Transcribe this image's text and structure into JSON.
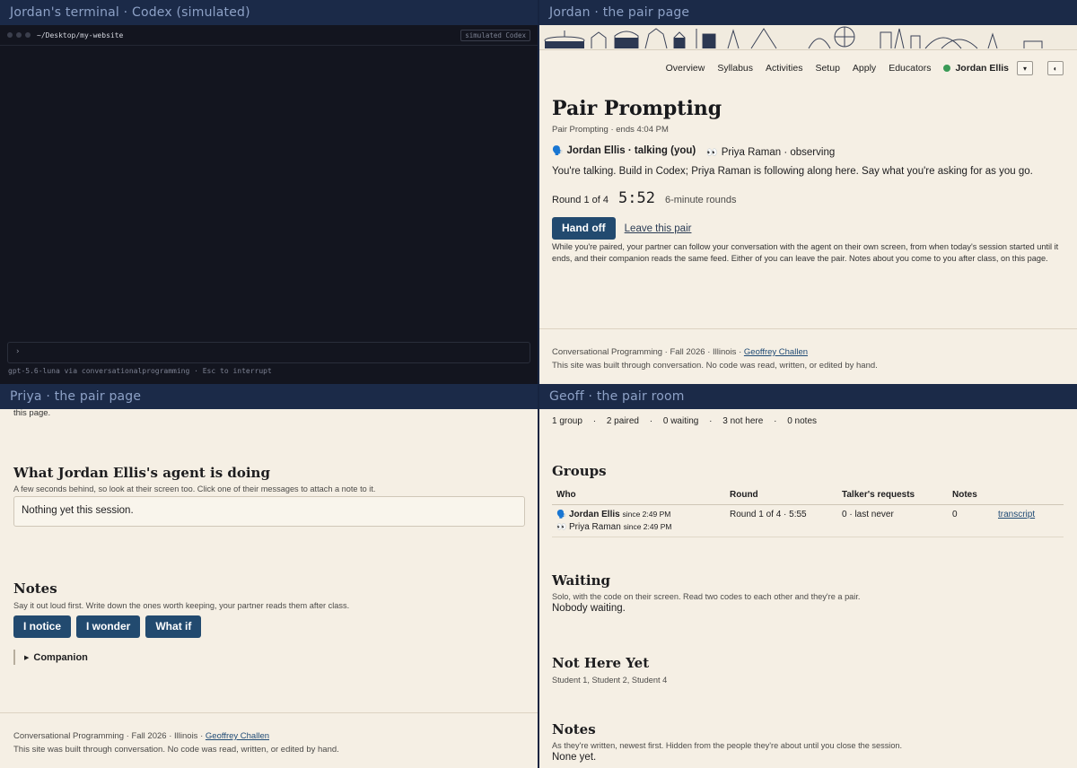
{
  "panes": {
    "terminal": {
      "label": "Jordan's terminal · Codex (simulated)",
      "path": "~/Desktop/my-website",
      "tag": "simulated Codex",
      "prompt_glyph": "›",
      "status": "gpt-5.6-luna via conversationalprogramming  ·  Esc to interrupt"
    },
    "jordan": {
      "label": "Jordan · the pair page"
    },
    "priya": {
      "label": "Priya · the pair page"
    },
    "geoff": {
      "label": "Geoff · the pair room"
    }
  },
  "nav": {
    "items": [
      "Overview",
      "Syllabus",
      "Activities",
      "Setup",
      "Apply",
      "Educators"
    ],
    "user": "Jordan Ellis",
    "dropdown_glyph": "▾",
    "theme_glyph": "◐"
  },
  "jordan_page": {
    "title": "Pair Prompting",
    "subtitle": "Pair Prompting · ends 4:04 PM",
    "talker_icon": "🗣️",
    "talker": "Jordan Ellis · talking (you)",
    "observer_icon": "👀",
    "observer": "Priya Raman · observing",
    "instruction": "You're talking. Build in Codex; Priya Raman is following along here. Say what you're asking for as you go.",
    "round": "Round 1 of 4",
    "timer": "5:52",
    "round_length": "6-minute rounds",
    "hand_off": "Hand off",
    "leave": "Leave this pair",
    "info": "While you're paired, your partner can follow your conversation with the agent on their own screen, from when today's session started until it ends, and their companion reads the same feed. Either of you can leave the pair. Notes about you come to you after class, on this page."
  },
  "footer": {
    "course": "Conversational Programming",
    "term": "Fall 2026",
    "school": "Illinois",
    "author": "Geoffrey Challen",
    "sep": "·",
    "note": "This site was built through conversation. No code was read, written, or edited by hand."
  },
  "priya_page": {
    "cut_text": "this page.",
    "agent_heading": "What Jordan Ellis's agent is doing",
    "agent_sub": "A few seconds behind, so look at their screen too. Click one of their messages to attach a note to it.",
    "agent_box": "Nothing yet this session.",
    "notes_heading": "Notes",
    "notes_sub": "Say it out loud first. Write down the ones worth keeping, your partner reads them after class.",
    "buttons": [
      "I notice",
      "I wonder",
      "What if"
    ],
    "companion_glyph": "▶",
    "companion": "Companion"
  },
  "geoff_page": {
    "stats": [
      "1 group",
      "2 paired",
      "0 waiting",
      "3 not here",
      "0 notes"
    ],
    "stat_sep": "·",
    "groups_heading": "Groups",
    "columns": [
      "Who",
      "Round",
      "Talker's requests",
      "Notes"
    ],
    "row": {
      "talker_icon": "🗣️",
      "talker": "Jordan Ellis",
      "talker_since": "since 2:49 PM",
      "observer_icon": "👀",
      "observer": "Priya Raman",
      "observer_since": "since 2:49 PM",
      "round": "Round 1 of 4 · 5:55",
      "requests": "0 · last never",
      "notes": "0",
      "transcript": "transcript"
    },
    "waiting_heading": "Waiting",
    "waiting_sub": "Solo, with the code on their screen. Read two codes to each other and they're a pair.",
    "waiting_text": "Nobody waiting.",
    "nothere_heading": "Not Here Yet",
    "nothere_text": "Student 1, Student 2, Student 4",
    "notes_heading": "Notes",
    "notes_sub": "As they're written, newest first. Hidden from the people they're about until you close the session.",
    "notes_text": "None yet."
  }
}
